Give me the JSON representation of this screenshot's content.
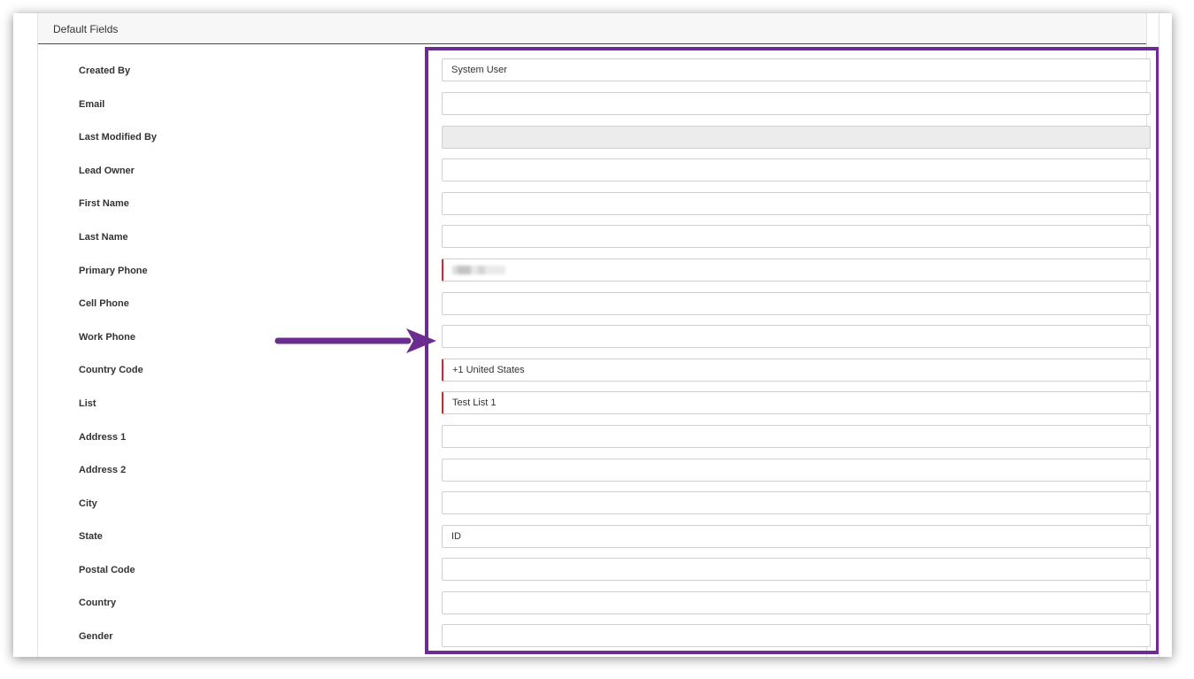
{
  "section": {
    "title": "Default Fields"
  },
  "fields": [
    {
      "label": "Created By",
      "value": "System User"
    },
    {
      "label": "Email",
      "value": ""
    },
    {
      "label": "Last Modified By",
      "value": ""
    },
    {
      "label": "Lead Owner",
      "value": ""
    },
    {
      "label": "First Name",
      "value": ""
    },
    {
      "label": "Last Name",
      "value": ""
    },
    {
      "label": "Primary Phone",
      "value": ""
    },
    {
      "label": "Cell Phone",
      "value": ""
    },
    {
      "label": "Work Phone",
      "value": ""
    },
    {
      "label": "Country Code",
      "value": "+1 United States"
    },
    {
      "label": "List",
      "value": "Test List 1"
    },
    {
      "label": "Address 1",
      "value": ""
    },
    {
      "label": "Address 2",
      "value": ""
    },
    {
      "label": "City",
      "value": ""
    },
    {
      "label": "State",
      "value": "ID"
    },
    {
      "label": "Postal Code",
      "value": ""
    },
    {
      "label": "Country",
      "value": ""
    },
    {
      "label": "Gender",
      "value": ""
    }
  ],
  "annotation": {
    "highlight_color": "#6b2d8f",
    "arrow_color": "#6b2d8f",
    "arrow_target": "Work Phone"
  },
  "colors": {
    "required_marker": "#d0262d",
    "header_underline": "#6b2d8f",
    "disabled_field": "#ececec"
  }
}
